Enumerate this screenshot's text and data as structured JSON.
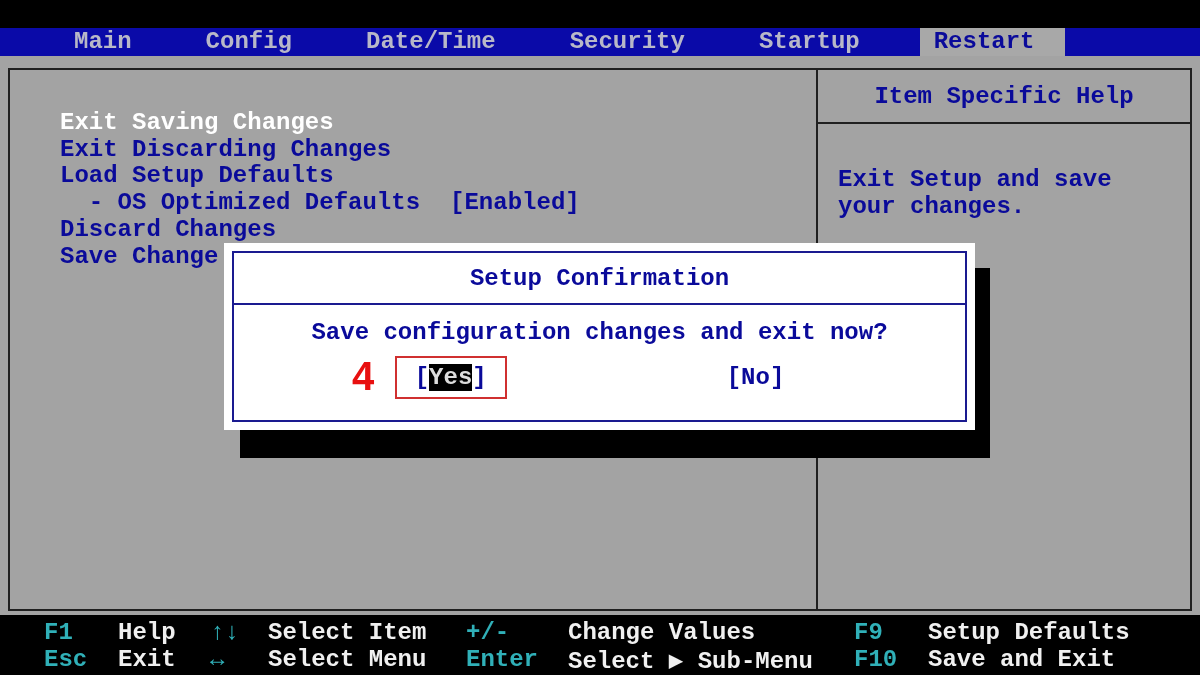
{
  "tabs": [
    {
      "label": "Main",
      "selected": false
    },
    {
      "label": "Config",
      "selected": false
    },
    {
      "label": "Date/Time",
      "selected": false
    },
    {
      "label": "Security",
      "selected": false
    },
    {
      "label": "Startup",
      "selected": false
    },
    {
      "label": "Restart",
      "selected": true
    }
  ],
  "menu": [
    {
      "kind": "item",
      "label": "Exit Saving Changes",
      "selected": true
    },
    {
      "kind": "item",
      "label": "Exit Discarding Changes",
      "selected": false
    },
    {
      "kind": "item",
      "label": "Load Setup Defaults",
      "selected": false
    },
    {
      "kind": "option",
      "label": "- OS Optimized Defaults",
      "value": "[Enabled]",
      "selected": false
    },
    {
      "kind": "item",
      "label": "Discard Changes",
      "selected": false
    },
    {
      "kind": "item",
      "label": "Save Change",
      "selected": false
    }
  ],
  "help": {
    "title": "Item Specific Help",
    "text": "Exit Setup and save your changes."
  },
  "dialog": {
    "title": "Setup Confirmation",
    "message": "Save configuration changes and exit now?",
    "buttons": [
      {
        "open": "[",
        "label": "Yes",
        "close": "]",
        "selected": true
      },
      {
        "open": "[",
        "label": "No",
        "close": "]",
        "selected": false
      }
    ],
    "annotation": "4"
  },
  "footer": [
    {
      "key": "F1",
      "action": "Help"
    },
    {
      "key": "↑↓",
      "action": "Select Item"
    },
    {
      "key": "+/-",
      "action": "Change Values"
    },
    {
      "key": "F9",
      "action": "Setup Defaults"
    },
    {
      "key": "Esc",
      "action": "Exit"
    },
    {
      "key": "↔",
      "action": "Select Menu"
    },
    {
      "key": "Enter",
      "action": "Select ▶ Sub-Menu"
    },
    {
      "key": "F10",
      "action": "Save and Exit"
    }
  ]
}
